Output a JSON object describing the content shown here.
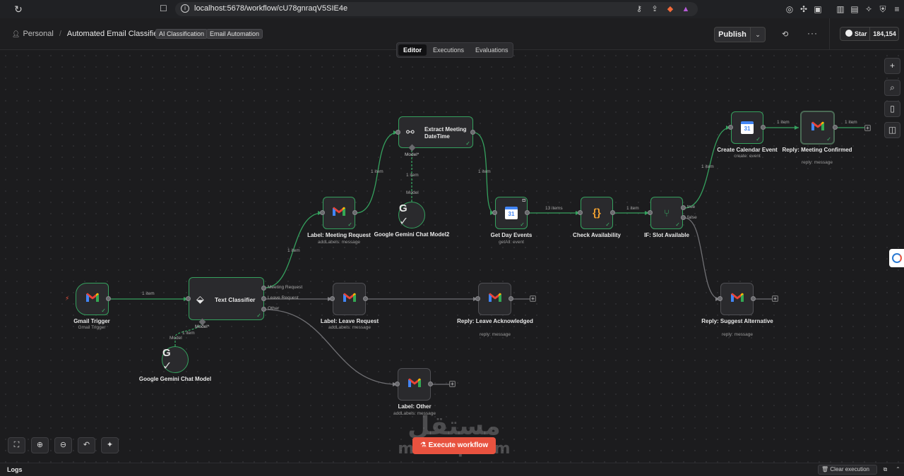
{
  "browser": {
    "url": "localhost:5678/workflow/cU78gnraqV5SIE4e"
  },
  "header": {
    "owner": "Personal",
    "workflow_title": "Automated Email Classifier",
    "tags": [
      "AI Classification",
      "Email Automation"
    ],
    "publish_label": "Publish",
    "github_star_label": "Star",
    "github_star_count": "184,154"
  },
  "tabs": [
    {
      "label": "Editor",
      "active": true
    },
    {
      "label": "Executions",
      "active": false
    },
    {
      "label": "Evaluations",
      "active": false
    }
  ],
  "nodes": {
    "gmail_trigger": {
      "label": "Gmail Trigger",
      "sub": "Gmail Trigger"
    },
    "text_classifier": {
      "label": "Text Classifier"
    },
    "gemini_model": {
      "label": "Google Gemini Chat Model"
    },
    "label_meeting": {
      "label": "Label: Meeting Request",
      "sub": "addLabels: message"
    },
    "extract_meeting": {
      "label": "Extract Meeting DateTime"
    },
    "gemini_model2": {
      "label": "Google Gemini Chat Model2"
    },
    "get_day_events": {
      "label": "Get Day Events",
      "sub": "getAll: event"
    },
    "check_availability": {
      "label": "Check Availability"
    },
    "if_slot": {
      "label": "IF: Slot Available"
    },
    "create_calendar": {
      "label": "Create Calendar Event",
      "sub": "create: event"
    },
    "reply_confirmed": {
      "label": "Reply: Meeting Confirmed",
      "sub": "reply: message"
    },
    "label_leave": {
      "label": "Label: Leave Request",
      "sub": "addLabels: message"
    },
    "reply_leave": {
      "label": "Reply: Leave Acknowledged",
      "sub": "reply: message"
    },
    "reply_suggest": {
      "label": "Reply: Suggest Alternative",
      "sub": "reply: message"
    },
    "label_other": {
      "label": "Label: Other",
      "sub": "addLabels: message"
    }
  },
  "classifier_branches": [
    "Meeting Request",
    "Leave Request",
    "Other"
  ],
  "if_branches": [
    "true",
    "false"
  ],
  "edge_labels": {
    "trigger_to_classifier": "1 item",
    "classifier_to_model": "1 item",
    "meeting_to_label": "1 item",
    "label_to_extract": "1 item",
    "extract_to_model2": "1 item",
    "extract_to_events": "1 item",
    "events_to_check": "13 items",
    "check_to_if": "1 item",
    "if_to_create": "1 item",
    "create_to_reply": "1 item",
    "reply_out": "1 item"
  },
  "port_labels": {
    "model": "Model",
    "model_required": "Model*"
  },
  "execute_label": "Execute workflow",
  "logs_label": "Logs",
  "clear_execution_label": "Clear execution",
  "watermark": {
    "arabic": "مستقل",
    "latin": "mostaql.com"
  },
  "colors": {
    "success": "#35a15e",
    "execute": "#e8523f",
    "canvas": "#1c1c1e"
  }
}
